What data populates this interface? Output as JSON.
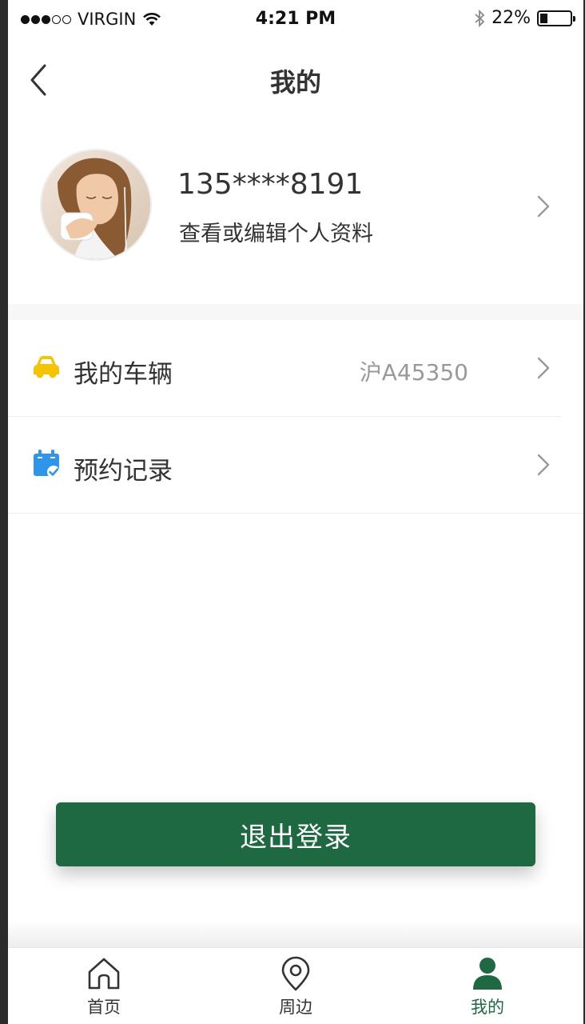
{
  "status_bar": {
    "carrier": "VIRGIN",
    "time": "4:21 PM",
    "battery": "22%",
    "battery_level": 0.22
  },
  "nav": {
    "title": "我的"
  },
  "profile": {
    "phone": "135****8191",
    "edit_label": "查看或编辑个人资料"
  },
  "menu": {
    "vehicle": {
      "label": "我的车辆",
      "value": "沪A45350",
      "icon": "car-icon"
    },
    "records": {
      "label": "预约记录",
      "icon": "calendar-check-icon"
    }
  },
  "logout_label": "退出登录",
  "tabs": [
    {
      "label": "首页",
      "icon": "home-icon"
    },
    {
      "label": "周边",
      "icon": "location-pin-icon"
    },
    {
      "label": "我的",
      "icon": "user-icon"
    }
  ],
  "colors": {
    "primary": "#1e6842",
    "text": "#333333",
    "secondary_text": "#999999",
    "divider": "#eeeeee",
    "gap": "#f7f7f7",
    "vehicle_icon": "#f5c400",
    "records_icon": "#2f95e8"
  }
}
